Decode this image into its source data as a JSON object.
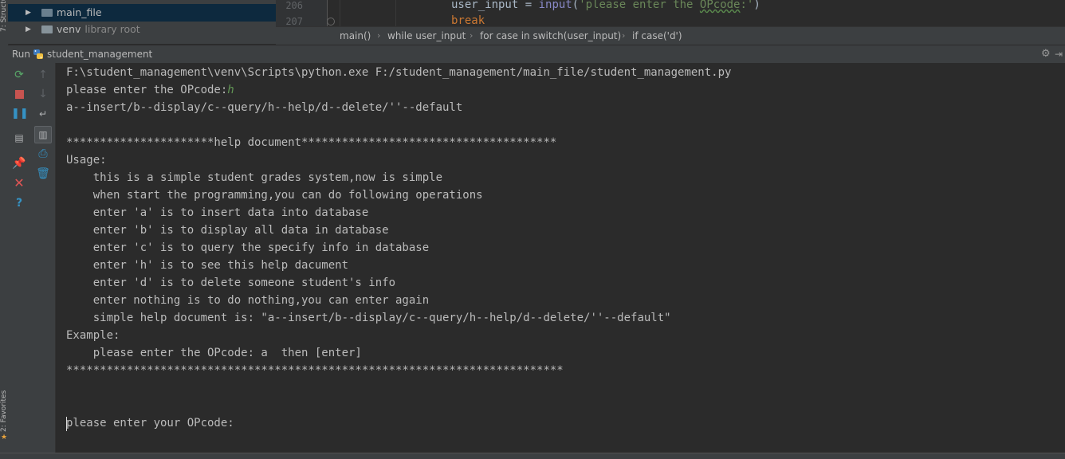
{
  "side_tabs": {
    "structure": "7: Structure",
    "favorites": "2: Favorites"
  },
  "project_tree": [
    {
      "label": "main_file",
      "sub": ""
    },
    {
      "label": "venv",
      "sub": "library root"
    }
  ],
  "editor": {
    "lines": [
      {
        "number": "206",
        "var": "user_input",
        "eq": " = ",
        "func": "input",
        "str": "'please enter the OPcode:'",
        "close": ")"
      },
      {
        "number": "207",
        "keyword": "break"
      }
    ]
  },
  "breadcrumb": [
    "main()",
    "while user_input",
    "for case in switch(user_input)",
    "if case('d')"
  ],
  "run_panel": {
    "label": "Run",
    "config": "student_management"
  },
  "console": {
    "lines": [
      "F:\\student_management\\venv\\Scripts\\python.exe F:/student_management/main_file/student_management.py",
      "please enter the OPcode:",
      "a--insert/b--display/c--query/h--help/d--delete/''--default",
      "",
      "**********************help document**************************************",
      "Usage:",
      "    this is a simple student grades system,now is simple",
      "    when start the programming,you can do following operations",
      "    enter 'a' is to insert data into database",
      "    enter 'b' is to display all data in database",
      "    enter 'c' is to query the specify info in database",
      "    enter 'h' is to see this help dacument",
      "    enter 'd' is to delete someone student's info",
      "    enter nothing is to do nothing,you can enter again",
      "    simple help document is: \"a--insert/b--display/c--query/h--help/d--delete/''--default\"",
      "Example:",
      "    please enter the OPcode: a  then [enter]",
      "**************************************************************************",
      "",
      "",
      "please enter your OPcode:"
    ],
    "user_input": "h"
  },
  "colors": {
    "background": "#2b2b2b",
    "panel": "#3c3f41",
    "console_text": "#bbbbbb",
    "user_input": "#629755",
    "string": "#6a8759",
    "keyword": "#cc7832",
    "builtin": "#8888c6"
  }
}
